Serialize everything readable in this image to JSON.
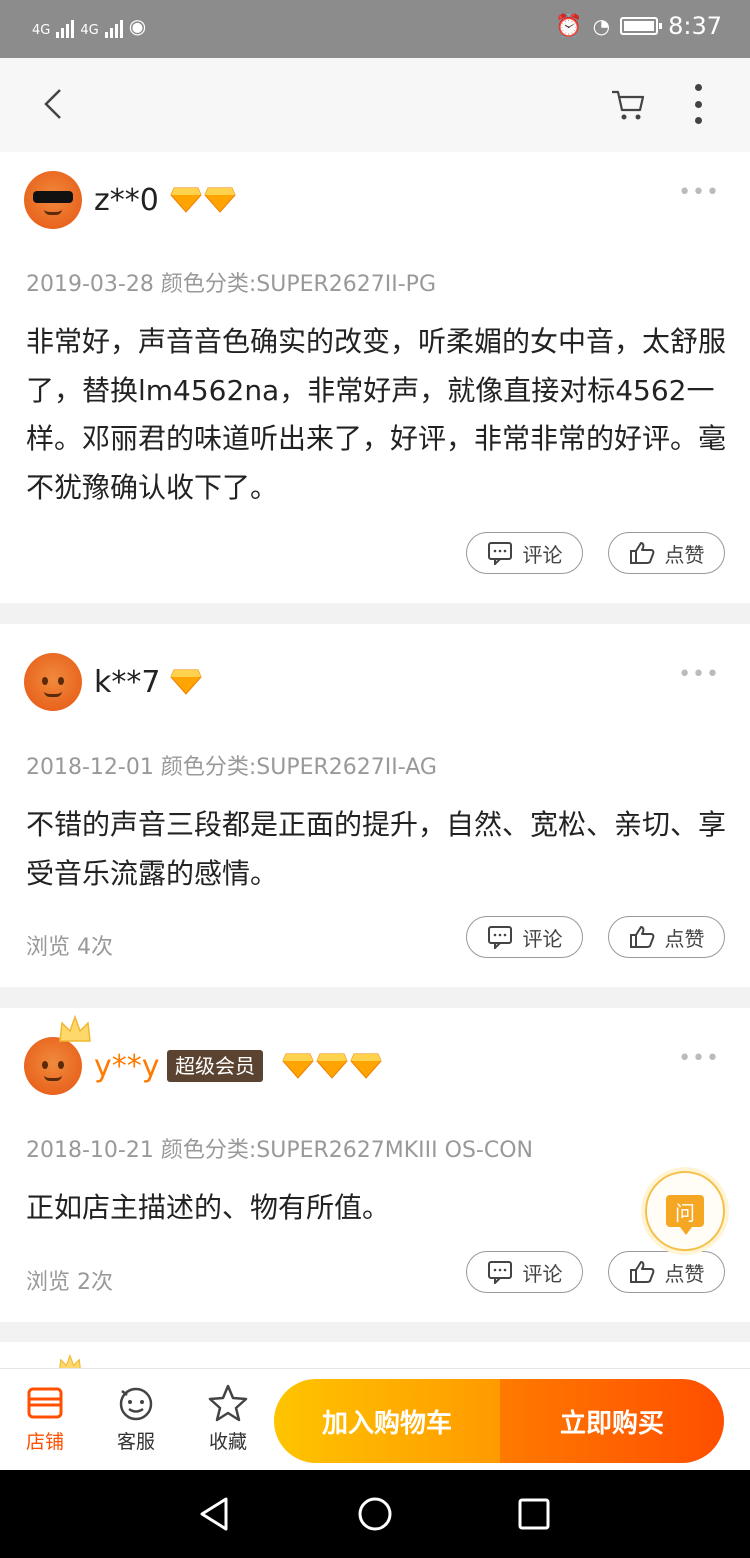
{
  "status_bar": {
    "signal1": "4G",
    "signal2": "4G",
    "time": "8:37"
  },
  "reviews": [
    {
      "username": "z**0",
      "gem_count": 2,
      "meta": "2019-03-28 颜色分类:SUPER2627II-PG",
      "content": "非常好，声音音色确实的改变，听柔媚的女中音，太舒服了，替换lm4562na，非常好声，就像直接对标4562一样。邓丽君的味道听出来了，好评，非常非常的好评。毫不犹豫确认收下了。",
      "comment_label": "评论",
      "like_label": "点赞"
    },
    {
      "username": "k**7",
      "gem_count": 1,
      "meta": "2018-12-01 颜色分类:SUPER2627II-AG",
      "content": "不错的声音三段都是正面的提升，自然、宽松、亲切、享受音乐流露的感情。",
      "views": "浏览 4次",
      "comment_label": "评论",
      "like_label": "点赞"
    },
    {
      "username": "y**y",
      "vip_badge": "超级会员",
      "gem_count": 3,
      "meta": "2018-10-21 颜色分类:SUPER2627MKIII OS-CON",
      "content": "正如店主描述的、物有所值。",
      "views": "浏览 2次",
      "comment_label": "评论",
      "like_label": "点赞"
    }
  ],
  "ask_button": "问",
  "bottom_bar": {
    "tabs": [
      {
        "label": "店铺",
        "icon": "store-icon"
      },
      {
        "label": "客服",
        "icon": "customer-service-icon"
      },
      {
        "label": "收藏",
        "icon": "star-icon"
      }
    ],
    "add_to_cart": "加入购物车",
    "buy_now": "立即购买"
  },
  "colors": {
    "accent": "#ff5000",
    "add_to_cart_start": "#ffc400",
    "buy_now_end": "#ff4e00",
    "vip_name": "#ff7a00"
  }
}
